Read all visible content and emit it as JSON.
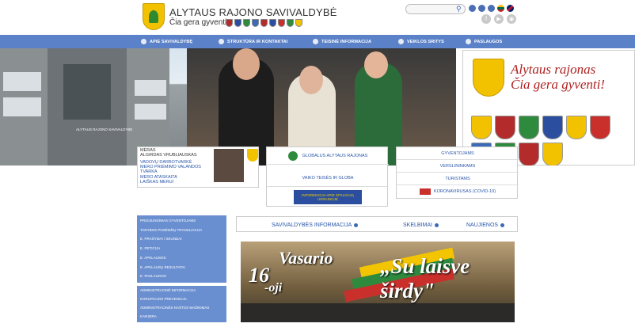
{
  "header": {
    "title": "ALYTAUS RAJONO SAVIVALDYBĖ",
    "slogan": "Čia gera gyventi!",
    "search": {
      "placeholder": ""
    }
  },
  "nav": {
    "items": [
      {
        "label": "APIE SAVIVALDYBĘ"
      },
      {
        "label": "STRUKTŪRA IR KONTAKTAI"
      },
      {
        "label": "TEISINĖ INFORMACIJA"
      },
      {
        "label": "VEIKLOS SRITYS"
      },
      {
        "label": "PASLAUGOS"
      }
    ]
  },
  "banner": {
    "building_sign": "ALYTAUS RAJONO SAVIVALDYBĖ",
    "panel_line1": "Alytaus rajonas",
    "panel_line2": "Čia gera gyventi!"
  },
  "mayor_box": {
    "lines": [
      "MERAS",
      "ALGIRDAS VRUBLIAUSKAS",
      "VADOVŲ DARBOTVARKĖ",
      "MERO PRIĖMIMO VALANDOS",
      "TVARKA",
      "MERO ATASKAITA",
      "LAIŠKAS MERUI"
    ]
  },
  "mid_box": {
    "rows": [
      "GLOBALUS ALYTAUS RAJONAS",
      "VAIKO TEISĖS IR GLOBA"
    ],
    "banner": "INFORMACIJA APIE SITUACIJĄ UKRAINOJE"
  },
  "right_box": {
    "rows": [
      "GYVENTOJAMS",
      "VERSLININKAMS",
      "TURISTAMS",
      "KORONAVIRUSAS (COVID-19)"
    ]
  },
  "sidebar_top": {
    "items": [
      "PRISIJUNGIMAS GYVENTOJAMS",
      "TARYBOS POSĖDŽIŲ TRANSLIACIJA",
      "E. PRAŠYMAI / SKUNDAI",
      "E. PETICIJA",
      "E. APKLAUSOS",
      "E. APKLAUSŲ REZULTATAI",
      "E. PASLAUGOS"
    ]
  },
  "sidebar_bottom": {
    "items": [
      "ADMINISTRACINĖ INFORMACIJA",
      "KORUPCIJOS PREVENCIJA",
      "ADMINISTRACINĖS NAŠTOS MAŽINIMAS",
      "KARJERA"
    ]
  },
  "tabs": {
    "items": [
      {
        "label": "SAVIVALDYBĖS INFORMACIJA"
      },
      {
        "label": "SKELBIMAI"
      },
      {
        "label": "NAUJIENOS"
      }
    ]
  },
  "feature": {
    "num": "16",
    "month": "Vasario",
    "suffix": "-oji",
    "slogan": "„Su laisve širdy\""
  }
}
